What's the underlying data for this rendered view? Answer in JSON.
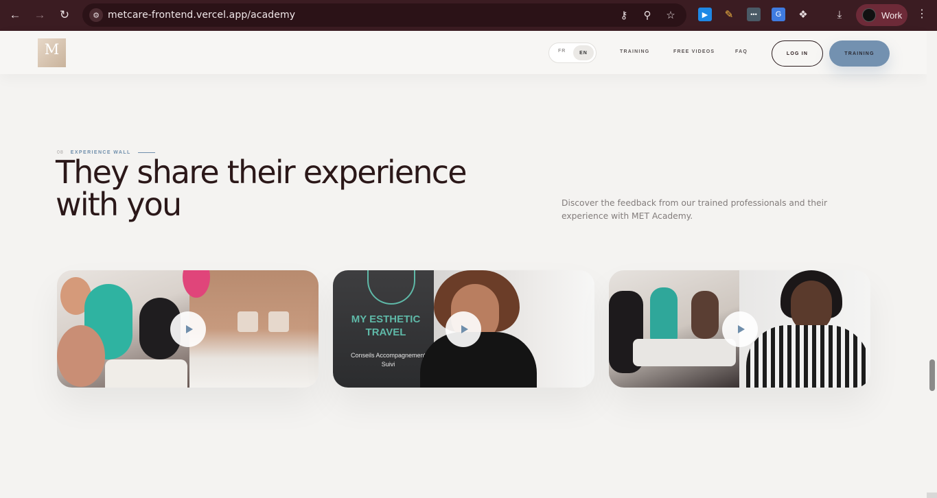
{
  "browser": {
    "url": "metcare-frontend.vercel.app/academy",
    "profile_label": "Work"
  },
  "header": {
    "logo_text": "M",
    "lang": {
      "fr": "FR",
      "en": "EN",
      "active": "EN"
    },
    "nav": [
      "TRAINING",
      "FREE VIDEOS",
      "FAQ"
    ],
    "login_label": "LOG IN",
    "cta_label": "TRAINING"
  },
  "section": {
    "number": "08",
    "label": "EXPERIENCE WALL",
    "title_line1": "They share their experience",
    "title_line2": "with you",
    "description": "Discover the feedback from our trained professionals and their experience with MET Academy."
  },
  "videos": [
    {
      "caption": ""
    },
    {
      "banner_title": "MY ESTHETIC TRAVEL",
      "banner_sub": "Conseils Accompagnement Suivi"
    },
    {
      "caption": ""
    }
  ],
  "colors": {
    "chrome": "#3b1c22",
    "accent": "#7391b0",
    "heading": "#2b1819",
    "background": "#f4f3f1"
  }
}
